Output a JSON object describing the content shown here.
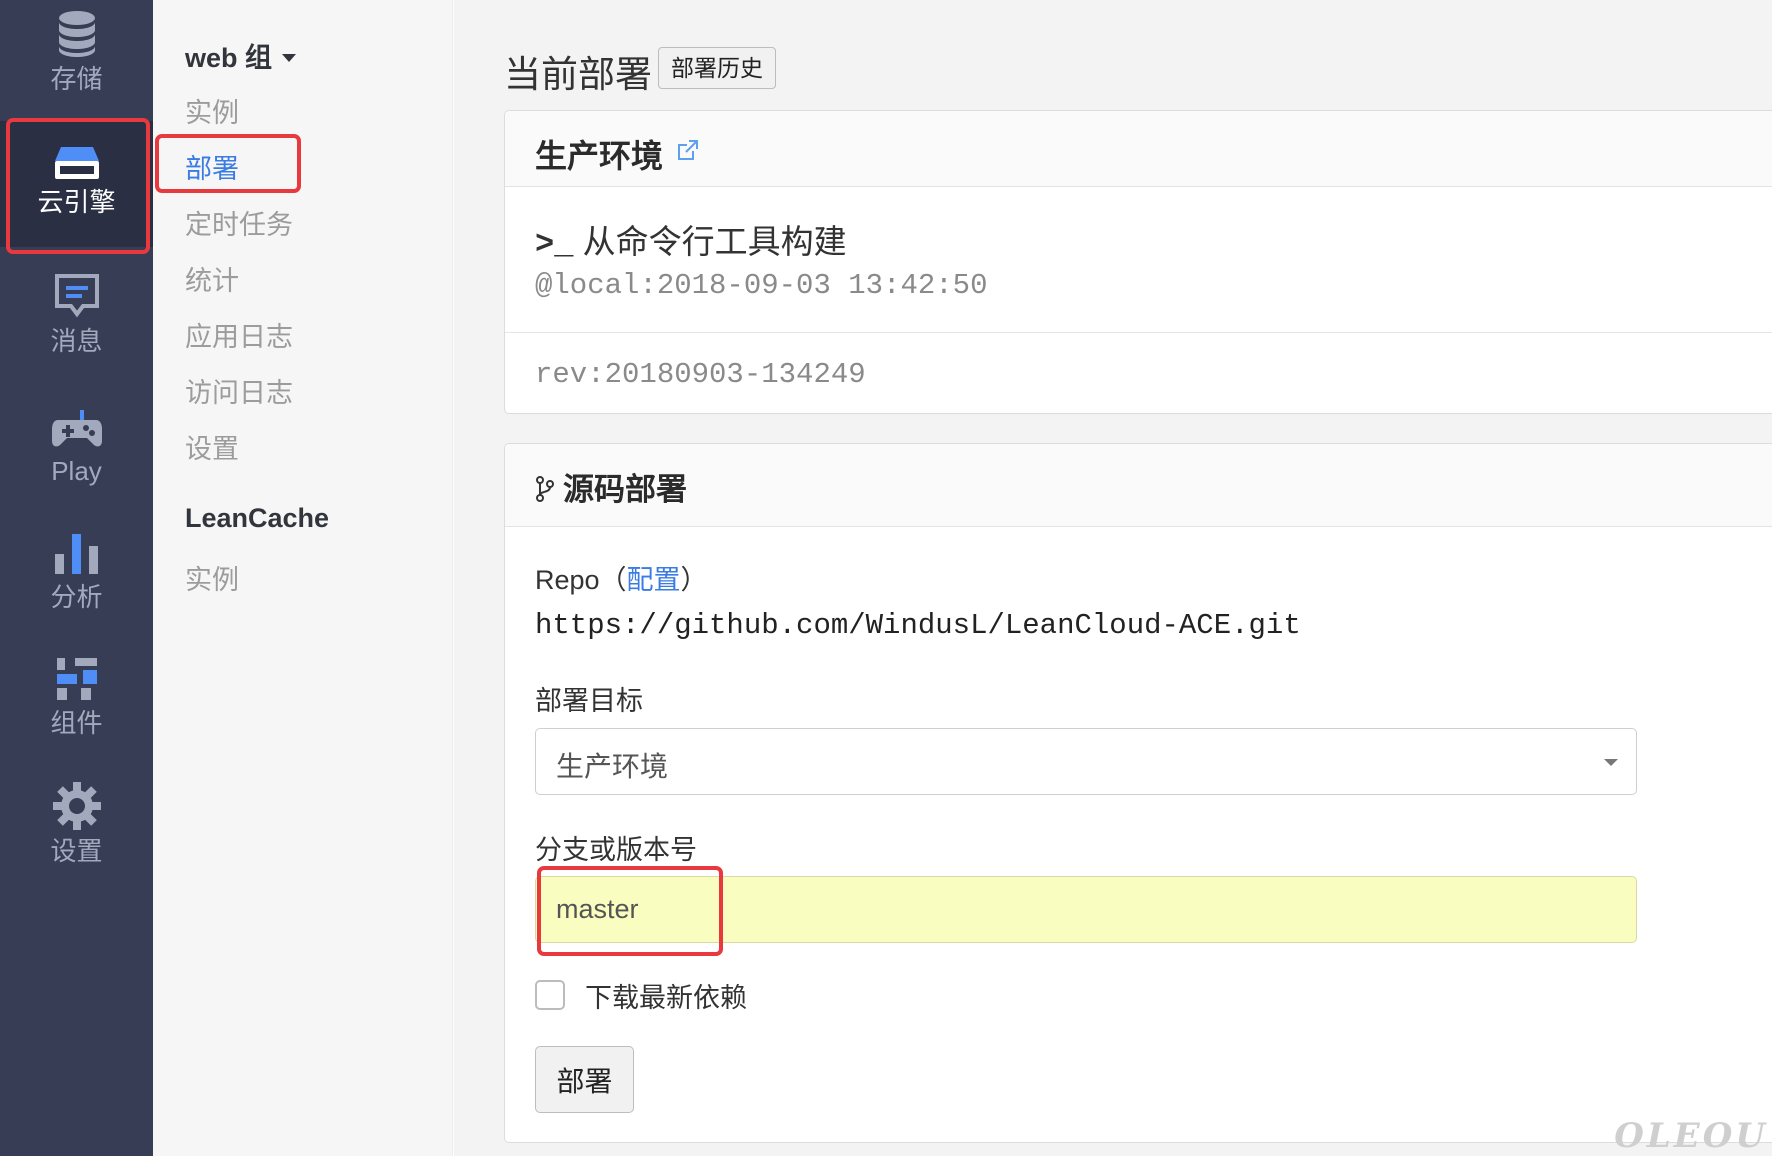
{
  "iconbar": {
    "items": [
      {
        "label": "存储",
        "icon": "database-icon"
      },
      {
        "label": "云引擎",
        "icon": "engine-icon"
      },
      {
        "label": "消息",
        "icon": "message-icon"
      },
      {
        "label": "Play",
        "icon": "gamepad-icon"
      },
      {
        "label": "分析",
        "icon": "bar-chart-icon"
      },
      {
        "label": "组件",
        "icon": "components-icon"
      },
      {
        "label": "设置",
        "icon": "gear-icon"
      }
    ],
    "active_index": 1
  },
  "subnav": {
    "group1": {
      "title": "web 组",
      "items": [
        "实例",
        "部署",
        "定时任务",
        "统计",
        "应用日志",
        "访问日志",
        "设置"
      ]
    },
    "group2": {
      "title": "LeanCache",
      "items": [
        "实例"
      ]
    },
    "active_item": "部署"
  },
  "main": {
    "title": "当前部署",
    "history_button": "部署历史",
    "env_panel": {
      "title": "生产环境",
      "cmd_prompt": ">_",
      "cmd_text": "从命令行工具构建",
      "deploy_time": "@local:2018-09-03 13:42:50",
      "rev": "rev:20180903-134249"
    },
    "source_panel": {
      "title": "源码部署",
      "repo_label_prefix": "Repo（",
      "repo_config_link": "配置",
      "repo_label_suffix": "）",
      "repo_url": "https://github.com/WindusL/LeanCloud-ACE.git",
      "target_label": "部署目标",
      "target_value": "生产环境",
      "branch_label": "分支或版本号",
      "branch_value": "master",
      "checkbox_label": "下载最新依赖",
      "checkbox_checked": false,
      "deploy_button": "部署"
    }
  },
  "watermark": "OLEOU",
  "colors": {
    "sidebar_bg": "#373d55",
    "accent_blue": "#3b7ce4",
    "highlight_red": "#e8393f",
    "input_yellow": "#fafdc0"
  }
}
